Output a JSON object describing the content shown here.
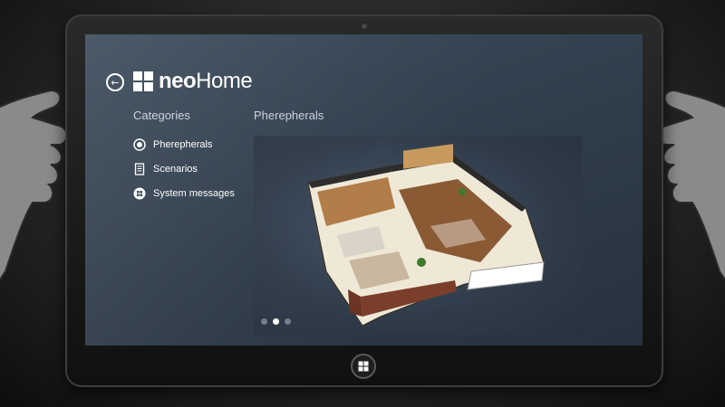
{
  "app": {
    "title_prefix": "neo",
    "title_suffix": "Home"
  },
  "sidebar": {
    "heading": "Categories",
    "items": [
      {
        "label": "Pherepherals",
        "icon": "plug-icon"
      },
      {
        "label": "Scenarios",
        "icon": "document-icon"
      },
      {
        "label": "System messages",
        "icon": "chat-icon"
      }
    ]
  },
  "main": {
    "heading": "Pherepherals",
    "carousel": {
      "slides": 3,
      "active_index": 1
    }
  },
  "colors": {
    "screen_bg": "#34424f",
    "accent": "#ffffff",
    "muted_text": "#c9d2dc"
  }
}
